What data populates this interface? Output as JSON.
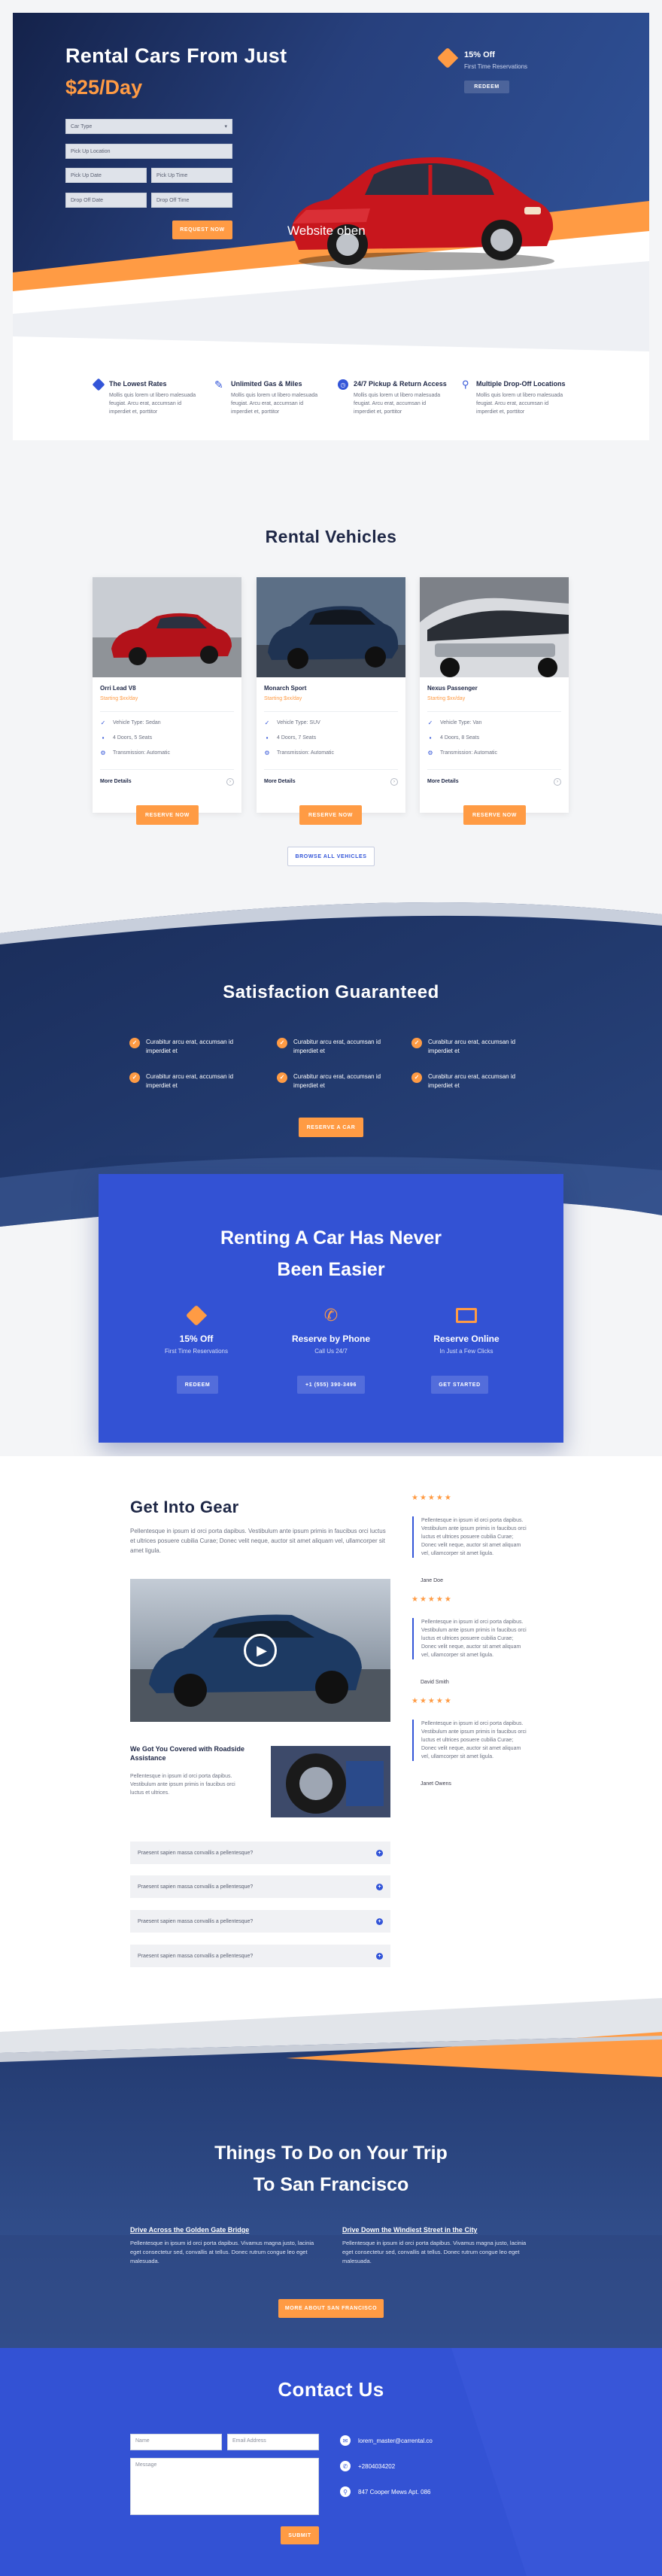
{
  "hero": {
    "title_line1": "Rental Cars From Just",
    "title_line2": "$25/Day",
    "promo_title": "15% Off",
    "promo_sub": "First Time Reservations",
    "promo_button": "Redeem",
    "form": {
      "car_type": "Car Type",
      "pickup_location": "Pick Up Location",
      "pickup_date": "Pick Up Date",
      "pickup_time": "Pick Up Time",
      "dropoff_date": "Drop Off Date",
      "dropoff_time": "Drop Off Time",
      "submit": "Request Now"
    },
    "image_caption": "Website oben"
  },
  "features": [
    {
      "title": "The Lowest Rates",
      "text": "Mollis quis lorem ut libero malesuada feugiat. Arcu erat, accumsan id imperdiet et, porttitor"
    },
    {
      "title": "Unlimited Gas & Miles",
      "text": "Mollis quis lorem ut libero malesuada feugiat. Arcu erat, accumsan id imperdiet et, porttitor"
    },
    {
      "title": "24/7 Pickup & Return Access",
      "text": "Mollis quis lorem ut libero malesuada feugiat. Arcu erat, accumsan id imperdiet et, porttitor"
    },
    {
      "title": "Multiple Drop-Off Locations",
      "text": "Mollis quis lorem ut libero malesuada feugiat. Arcu erat, accumsan id imperdiet et, porttitor"
    }
  ],
  "vehicles": {
    "heading": "Rental Vehicles",
    "items": [
      {
        "name": "Orri Lead V8",
        "price": "Starting $xx/day",
        "type": "Vehicle Type: Sedan",
        "doors": "4 Doors, 5 Seats",
        "trans": "Transmission: Automatic",
        "more": "More Details",
        "reserve": "Reserve Now"
      },
      {
        "name": "Monarch Sport",
        "price": "Starting $xx/day",
        "type": "Vehicle Type: SUV",
        "doors": "4 Doors, 7 Seats",
        "trans": "Transmission: Automatic",
        "more": "More Details",
        "reserve": "Reserve Now"
      },
      {
        "name": "Nexus Passenger",
        "price": "Starting $xx/day",
        "type": "Vehicle Type: Van",
        "doors": "4 Doors, 8 Seats",
        "trans": "Transmission: Automatic",
        "more": "More Details",
        "reserve": "Reserve Now"
      }
    ],
    "browse": "Browse All Vehicles"
  },
  "satisfaction": {
    "heading": "Satisfaction Guaranteed",
    "items": [
      "Curabitur arcu erat, accumsan id imperdiet et",
      "Curabitur arcu erat, accumsan id imperdiet et",
      "Curabitur arcu erat, accumsan id imperdiet et",
      "Curabitur arcu erat, accumsan id imperdiet et",
      "Curabitur arcu erat, accumsan id imperdiet et",
      "Curabitur arcu erat, accumsan id imperdiet et"
    ],
    "button": "Reserve a Car"
  },
  "renting": {
    "heading_line1": "Renting A Car Has Never",
    "heading_line2": "Been Easier",
    "cols": [
      {
        "title": "15% Off",
        "sub": "First Time Reservations",
        "button": "Redeem"
      },
      {
        "title": "Reserve by Phone",
        "sub": "Call Us 24/7",
        "button": "+1 (555) 390-3496"
      },
      {
        "title": "Reserve Online",
        "sub": "In Just a Few Clicks",
        "button": "Get Started"
      }
    ]
  },
  "gear": {
    "heading": "Get Into Gear",
    "intro": "Pellentesque in ipsum id orci porta dapibus. Vestibulum ante ipsum primis in faucibus orci luctus et ultrices posuere cubilia Curae; Donec velit neque, auctor sit amet aliquam vel, ullamcorper sit amet ligula.",
    "roadside_title": "We Got You Covered with Roadside Assistance",
    "roadside_text": "Pellentesque in ipsum id orci porta dapibus. Vestibulum ante ipsum primis in faucibus orci luctus et ultrices.",
    "faq": [
      "Praesent sapien massa convallis a pellentesque?",
      "Praesent sapien massa convallis a pellentesque?",
      "Praesent sapien massa convallis a pellentesque?",
      "Praesent sapien massa convallis a pellentesque?"
    ],
    "reviews": [
      {
        "stars": "★★★★★",
        "text": "Pellentesque in ipsum id orci porta dapibus. Vestibulum ante ipsum primis in faucibus orci luctus et ultrices posuere cubilia Curae; Donec velit neque, auctor sit amet aliquam vel, ullamcorper sit amet ligula.",
        "name": "Jane Doe"
      },
      {
        "stars": "★★★★★",
        "text": "Pellentesque in ipsum id orci porta dapibus. Vestibulum ante ipsum primis in faucibus orci luctus et ultrices posuere cubilia Curae; Donec velit neque, auctor sit amet aliquam vel, ullamcorper sit amet ligula.",
        "name": "David Smith"
      },
      {
        "stars": "★★★★★",
        "text": "Pellentesque in ipsum id orci porta dapibus. Vestibulum ante ipsum primis in faucibus orci luctus et ultrices posuere cubilia Curae; Donec velit neque, auctor sit amet aliquam vel, ullamcorper sit amet ligula.",
        "name": "Janet Owens"
      }
    ]
  },
  "things": {
    "heading_line1": "Things To Do on Your Trip",
    "heading_line2": "To San Francisco",
    "items": [
      {
        "title": "Drive Across the Golden Gate Bridge",
        "text": "Pellentesque in ipsum id orci porta dapibus. Vivamus magna justo, lacinia eget consectetur sed, convallis at tellus. Donec rutrum congue leo eget malesuada."
      },
      {
        "title": "Drive Down the Windiest Street in the City",
        "text": "Pellentesque in ipsum id orci porta dapibus. Vivamus magna justo, lacinia eget consectetur sed, convallis at tellus. Donec rutrum congue leo eget malesuada."
      }
    ],
    "button": "More About San Francisco"
  },
  "contact": {
    "heading": "Contact Us",
    "name_ph": "Name",
    "email_ph": "Email Address",
    "message_ph": "Message",
    "submit": "Submit",
    "email": "lorem_master@carrental.co",
    "phone": "+2804034202",
    "address": "847 Cooper Mews Apt. 086"
  }
}
